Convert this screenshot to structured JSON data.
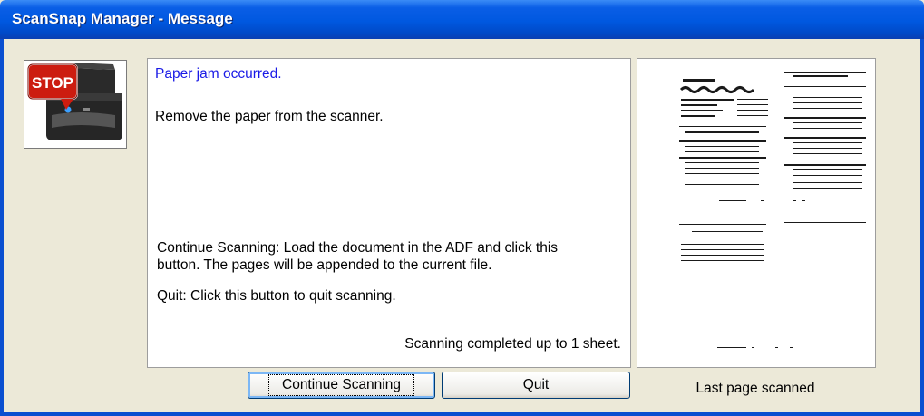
{
  "window": {
    "title": "ScanSnap Manager - Message"
  },
  "icon": {
    "name": "stop-scanner-icon",
    "badge_text": "STOP"
  },
  "message": {
    "title": "Paper jam occurred.",
    "instruction": "Remove the paper from the scanner.",
    "continue_line1": "Continue Scanning: Load the document in the ADF and click this",
    "continue_line2": "button. The pages will be appended to the current file.",
    "quit_help": "Quit: Click this button to quit scanning.",
    "status": "Scanning completed up to 1 sheet."
  },
  "buttons": {
    "continue_label": "Continue Scanning",
    "quit_label": "Quit"
  },
  "preview": {
    "caption": "Last page scanned"
  },
  "colors": {
    "title_bar": "#0058e0",
    "message_title": "#1a1ae6",
    "stop_red": "#cc1c10",
    "dialog_bg": "#ece9d8"
  }
}
